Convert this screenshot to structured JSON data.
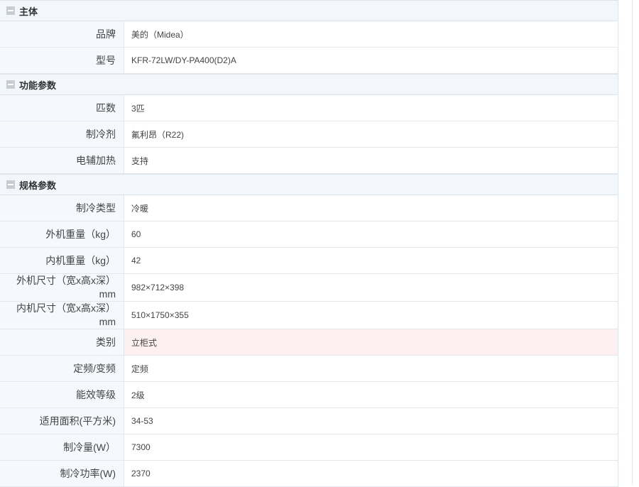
{
  "sections": [
    {
      "title": "主体",
      "rows": [
        {
          "key": "品牌",
          "value": "美的（Midea）"
        },
        {
          "key": "型号",
          "value": "KFR-72LW/DY-PA400(D2)A"
        }
      ]
    },
    {
      "title": "功能参数",
      "rows": [
        {
          "key": "匹数",
          "value": "3匹"
        },
        {
          "key": "制冷剂",
          "value": "氟利昂（R22)"
        },
        {
          "key": "电辅加热",
          "value": "支持"
        }
      ]
    },
    {
      "title": "规格参数",
      "rows": [
        {
          "key": "制冷类型",
          "value": "冷暖"
        },
        {
          "key": "外机重量（kg）",
          "value": "60"
        },
        {
          "key": "内机重量（kg）",
          "value": "42"
        },
        {
          "key": "外机尺寸（宽x高x深）mm",
          "value": "982×712×398"
        },
        {
          "key": "内机尺寸（宽x高x深）mm",
          "value": "510×1750×355"
        },
        {
          "key": "类别",
          "value": "立柜式"
        },
        {
          "key": "定频/变频",
          "value": "定频"
        },
        {
          "key": "能效等级",
          "value": "2级"
        },
        {
          "key": "适用面积(平方米)",
          "value": "34-53"
        },
        {
          "key": "制冷量(W）",
          "value": "7300"
        },
        {
          "key": "制冷功率(W)",
          "value": "2370"
        }
      ]
    }
  ]
}
